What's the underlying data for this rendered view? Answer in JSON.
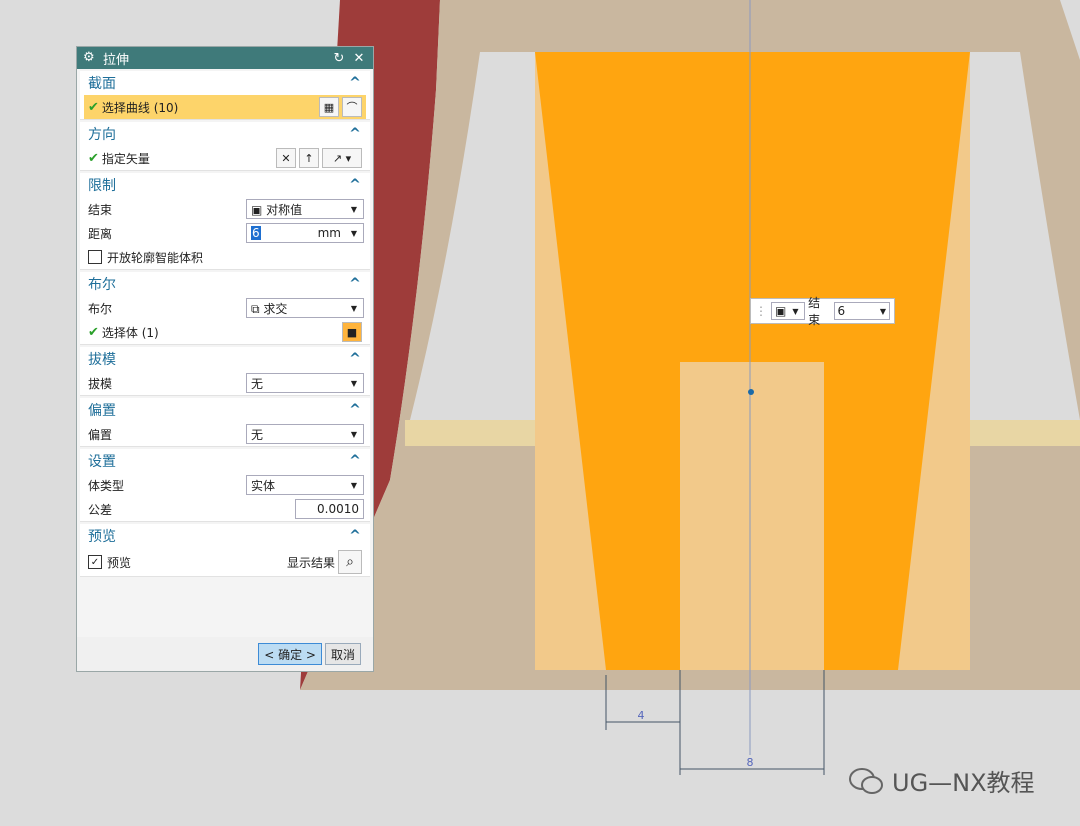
{
  "dialog": {
    "title": "拉伸",
    "sections": {
      "section": {
        "title": "截面",
        "select_curve": "选择曲线 (10)"
      },
      "direction": {
        "title": "方向",
        "vector": "指定矢量"
      },
      "limits": {
        "title": "限制",
        "end_label": "结束",
        "end_value": "对称值",
        "distance_label": "距离",
        "distance_value": "6",
        "distance_unit": "mm",
        "open_profile": "开放轮廓智能体积"
      },
      "boolean": {
        "title": "布尔",
        "bool_label": "布尔",
        "bool_value": "求交",
        "select_body": "选择体 (1)"
      },
      "draft": {
        "title": "拔模",
        "draft_label": "拔模",
        "draft_value": "无"
      },
      "offset": {
        "title": "偏置",
        "offset_label": "偏置",
        "offset_value": "无"
      },
      "settings": {
        "title": "设置",
        "body_type_label": "体类型",
        "body_type_value": "实体",
        "tolerance_label": "公差",
        "tolerance_value": "0.0010"
      },
      "preview": {
        "title": "预览",
        "preview_label": "预览",
        "show_result": "显示结果"
      }
    },
    "buttons": {
      "ok": "< 确定 >",
      "cancel": "取消"
    }
  },
  "floating_tag": {
    "label": "结束",
    "value": "6"
  },
  "dimensions": {
    "left": "4",
    "bottom": "8"
  },
  "watermark": "UG—NX教程",
  "colors": {
    "titlebar": "#3f7a7a",
    "accent": "#1f6f9a",
    "solid": "#ffa510",
    "selection": "#fdd46a"
  }
}
